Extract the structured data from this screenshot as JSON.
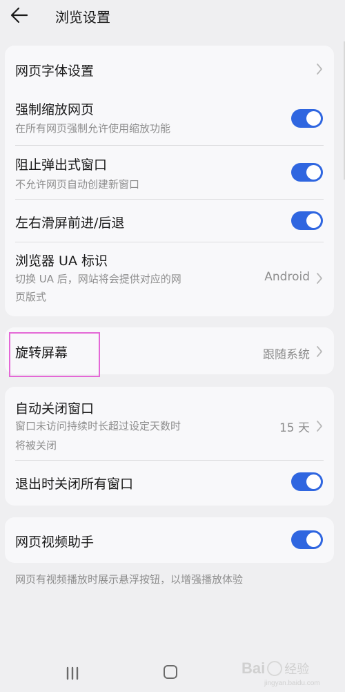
{
  "header": {
    "title": "浏览设置",
    "back_icon": "arrow-left-icon"
  },
  "card1": {
    "font_setting": {
      "label": "网页字体设置"
    },
    "force_zoom": {
      "label": "强制缩放网页",
      "desc": "在所有网页强制允许使用缩放功能",
      "enabled": true
    },
    "block_popup": {
      "label": "阻止弹出式窗口",
      "desc": "不允许网页自动创建新窗口",
      "enabled": true
    },
    "swipe_nav": {
      "label": "左右滑屏前进/后退",
      "enabled": true
    },
    "user_agent": {
      "label": "浏览器 UA 标识",
      "desc_line1": "切换 UA 后，网站将会提供对应的网",
      "desc_line2": "页版式",
      "value": "Android"
    }
  },
  "card2": {
    "rotate_screen": {
      "label": "旋转屏幕",
      "value": "跟随系统"
    }
  },
  "card3": {
    "auto_close": {
      "label": "自动关闭窗口",
      "desc_line1": "窗口未访问持续时长超过设定天数时",
      "desc_line2": "将被关闭",
      "value": "15 天"
    },
    "close_on_exit": {
      "label": "退出时关闭所有窗口",
      "enabled": true
    }
  },
  "card4": {
    "video_helper": {
      "label": "网页视频助手",
      "enabled": true
    }
  },
  "footnote": "网页有视频播放时展示悬浮按钮，以增强播放体验",
  "watermark": {
    "brand": "Bai",
    "suffix": "经验",
    "url": "jingyan.baidu.com"
  },
  "colors": {
    "accent": "#2f66e0",
    "highlight": "#e468d6",
    "background": "#efeff1",
    "card": "#f8f8fa"
  }
}
